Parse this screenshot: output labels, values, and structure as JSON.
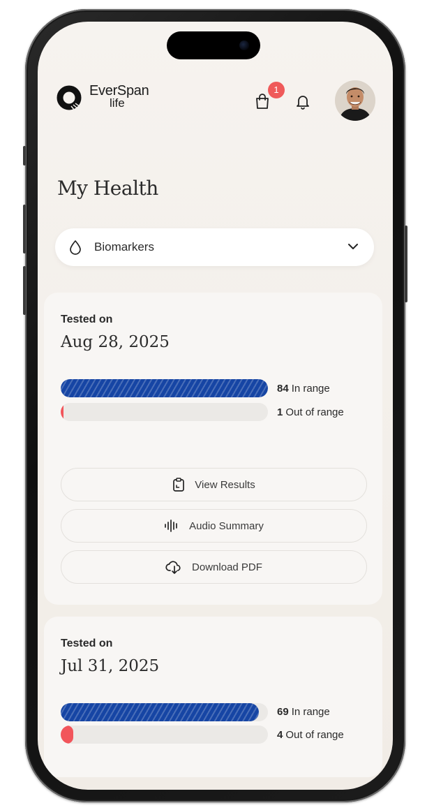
{
  "header": {
    "brand_line1": "EverSpan",
    "brand_line2": "life",
    "cart_badge": "1"
  },
  "page_title": "My Health",
  "dropdown": {
    "selected": "Biomarkers"
  },
  "results": [
    {
      "tested_label": "Tested on",
      "date": "Aug 28, 2025",
      "in_range_count": "84",
      "in_range_label": "In range",
      "out_range_count": "1",
      "out_range_label": "Out of range",
      "in_range_fraction": 1.0,
      "out_range_fraction": 0.012,
      "actions": {
        "view": "View Results",
        "audio": "Audio Summary",
        "download": "Download PDF"
      }
    },
    {
      "tested_label": "Tested on",
      "date": "Jul 31, 2025",
      "in_range_count": "69",
      "in_range_label": "In range",
      "out_range_count": "4",
      "out_range_label": "Out of range",
      "in_range_fraction": 0.955,
      "out_range_fraction": 0.06
    }
  ],
  "colors": {
    "in_range": "#1645a4",
    "out_range": "#f2555b",
    "badge": "#ef5a5a"
  },
  "icons": [
    "logo-icon",
    "shopping-bag-icon",
    "bell-icon",
    "water-drop-icon",
    "chevron-down-icon",
    "clipboard-icon",
    "audio-wave-icon",
    "cloud-download-icon"
  ]
}
